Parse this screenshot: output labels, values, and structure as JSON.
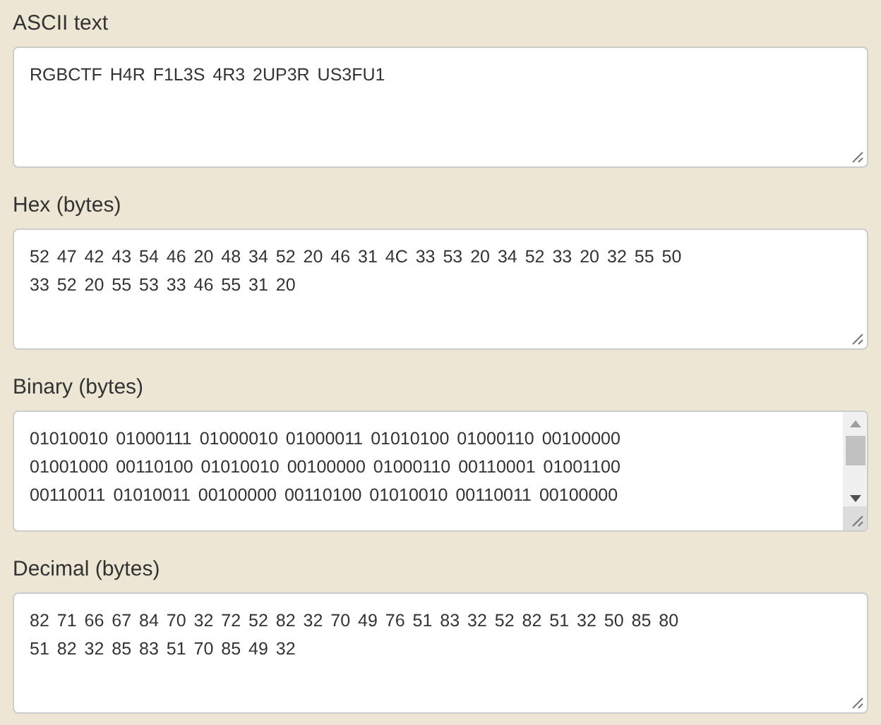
{
  "fields": [
    {
      "label": "ASCII text",
      "kind": "plain",
      "lines": [
        "RGBCTF H4R F1L3S 4R3 2UP3R US3FU1"
      ]
    },
    {
      "label": "Hex (bytes)",
      "kind": "plain",
      "lines": [
        "52 47 42 43 54 46 20 48 34 52 20 46 31 4C 33 53 20 34 52 33 20 32 55 50",
        "33 52 20 55 53 33 46 55 31 20"
      ]
    },
    {
      "label": "Binary (bytes)",
      "kind": "scroll",
      "lines": [
        "01010010 01000111 01000010 01000011 01010100 01000110 00100000",
        "01001000 00110100 01010010 00100000 01000110 00110001 01001100",
        "00110011 01010011 00100000 00110100 01010010 00110011 00100000"
      ]
    },
    {
      "label": "Decimal (bytes)",
      "kind": "plain",
      "lines": [
        "82 71 66 67 84 70 32 72 52 82 32 70 49 76 51 83 32 52 82 51 32 50 85 80",
        "51 82 32 85 83 51 70 85 49 32"
      ]
    }
  ]
}
